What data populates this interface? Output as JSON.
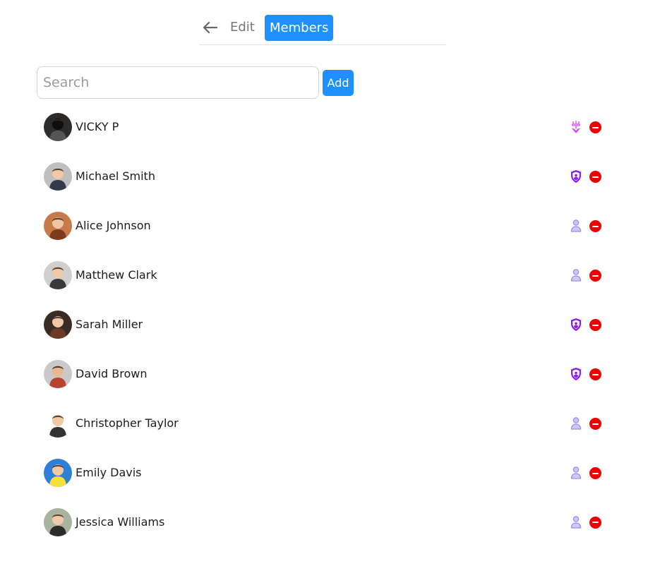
{
  "tabs": {
    "edit_label": "Edit",
    "members_label": "Members"
  },
  "search": {
    "placeholder": "Search",
    "value": ""
  },
  "add_label": "Add",
  "members": [
    {
      "name": "VICKY P",
      "role_icon": "owner-icon",
      "avatar": [
        "#2b2b2b",
        "#0e0e0e",
        "#555555"
      ]
    },
    {
      "name": "Michael Smith",
      "role_icon": "admin-shield-icon",
      "avatar": [
        "#bfbfbf",
        "#f1c9a5",
        "#333a4a"
      ]
    },
    {
      "name": "Alice Johnson",
      "role_icon": "member-user-icon",
      "avatar": [
        "#c77a4a",
        "#f0c5a0",
        "#7a3b1e"
      ]
    },
    {
      "name": "Matthew Clark",
      "role_icon": "member-user-icon",
      "avatar": [
        "#cfcfcf",
        "#f0c9a8",
        "#3a3a3a"
      ]
    },
    {
      "name": "Sarah Miller",
      "role_icon": "admin-shield-icon",
      "avatar": [
        "#3a2a24",
        "#f1c7a6",
        "#6b3b25"
      ]
    },
    {
      "name": "David Brown",
      "role_icon": "admin-shield-icon",
      "avatar": [
        "#c9c9c9",
        "#e8b892",
        "#b5452e"
      ]
    },
    {
      "name": "Christopher Taylor",
      "role_icon": "member-user-icon",
      "avatar": [
        "#ffffff",
        "#f2c9a5",
        "#333333"
      ]
    },
    {
      "name": "Emily Davis",
      "role_icon": "member-user-icon",
      "avatar": [
        "#2f7fd9",
        "#f3c7a0",
        "#f3e03a"
      ]
    },
    {
      "name": "Jessica Williams",
      "role_icon": "member-user-icon",
      "avatar": [
        "#a9b4a0",
        "#f1c8a8",
        "#2b2b2b"
      ]
    }
  ],
  "colors": {
    "accent": "#1e90ff",
    "remove": "#ee0000",
    "admin": "#8a1bf0",
    "member": "#9a8cf0",
    "owner": "#c94bf5"
  }
}
